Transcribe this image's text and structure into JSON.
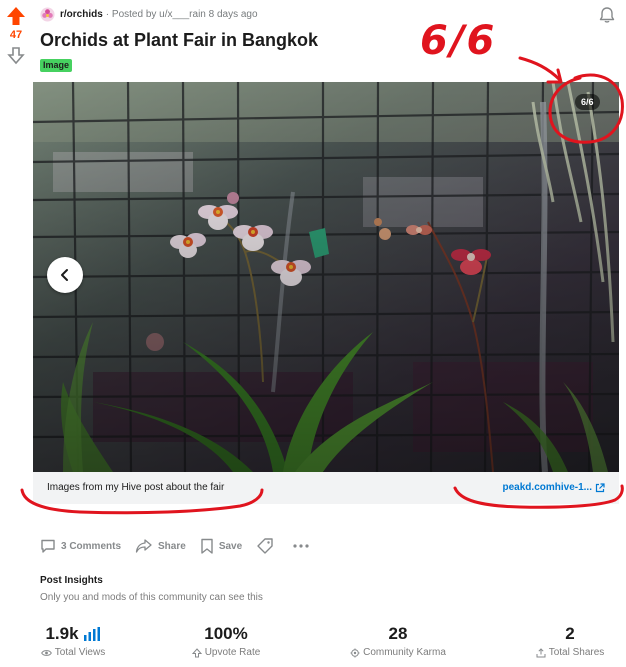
{
  "vote": {
    "count": "47"
  },
  "header": {
    "subreddit": "r/orchids",
    "byline": "· Posted by u/x___rain 8 days ago"
  },
  "post": {
    "title": "Orchids at Plant Fair in Bangkok",
    "flair": "Image"
  },
  "gallery": {
    "counter": "6/6",
    "caption": "Images from my Hive post about the fair",
    "link_text": "peakd.comhive-1..."
  },
  "actions": {
    "comments": "3 Comments",
    "share": "Share",
    "save": "Save"
  },
  "insights": {
    "title": "Post Insights",
    "subtitle": "Only you and mods of this community can see this",
    "stats": [
      {
        "value": "1.9k",
        "label": "Total Views"
      },
      {
        "value": "100%",
        "label": "Upvote Rate"
      },
      {
        "value": "28",
        "label": "Community Karma"
      },
      {
        "value": "2",
        "label": "Total Shares"
      }
    ]
  },
  "annotation": {
    "text": "6/6"
  },
  "colors": {
    "upvote": "#ff4500",
    "flair": "#46d160",
    "link": "#0079d3",
    "annotation": "#e0141e"
  }
}
